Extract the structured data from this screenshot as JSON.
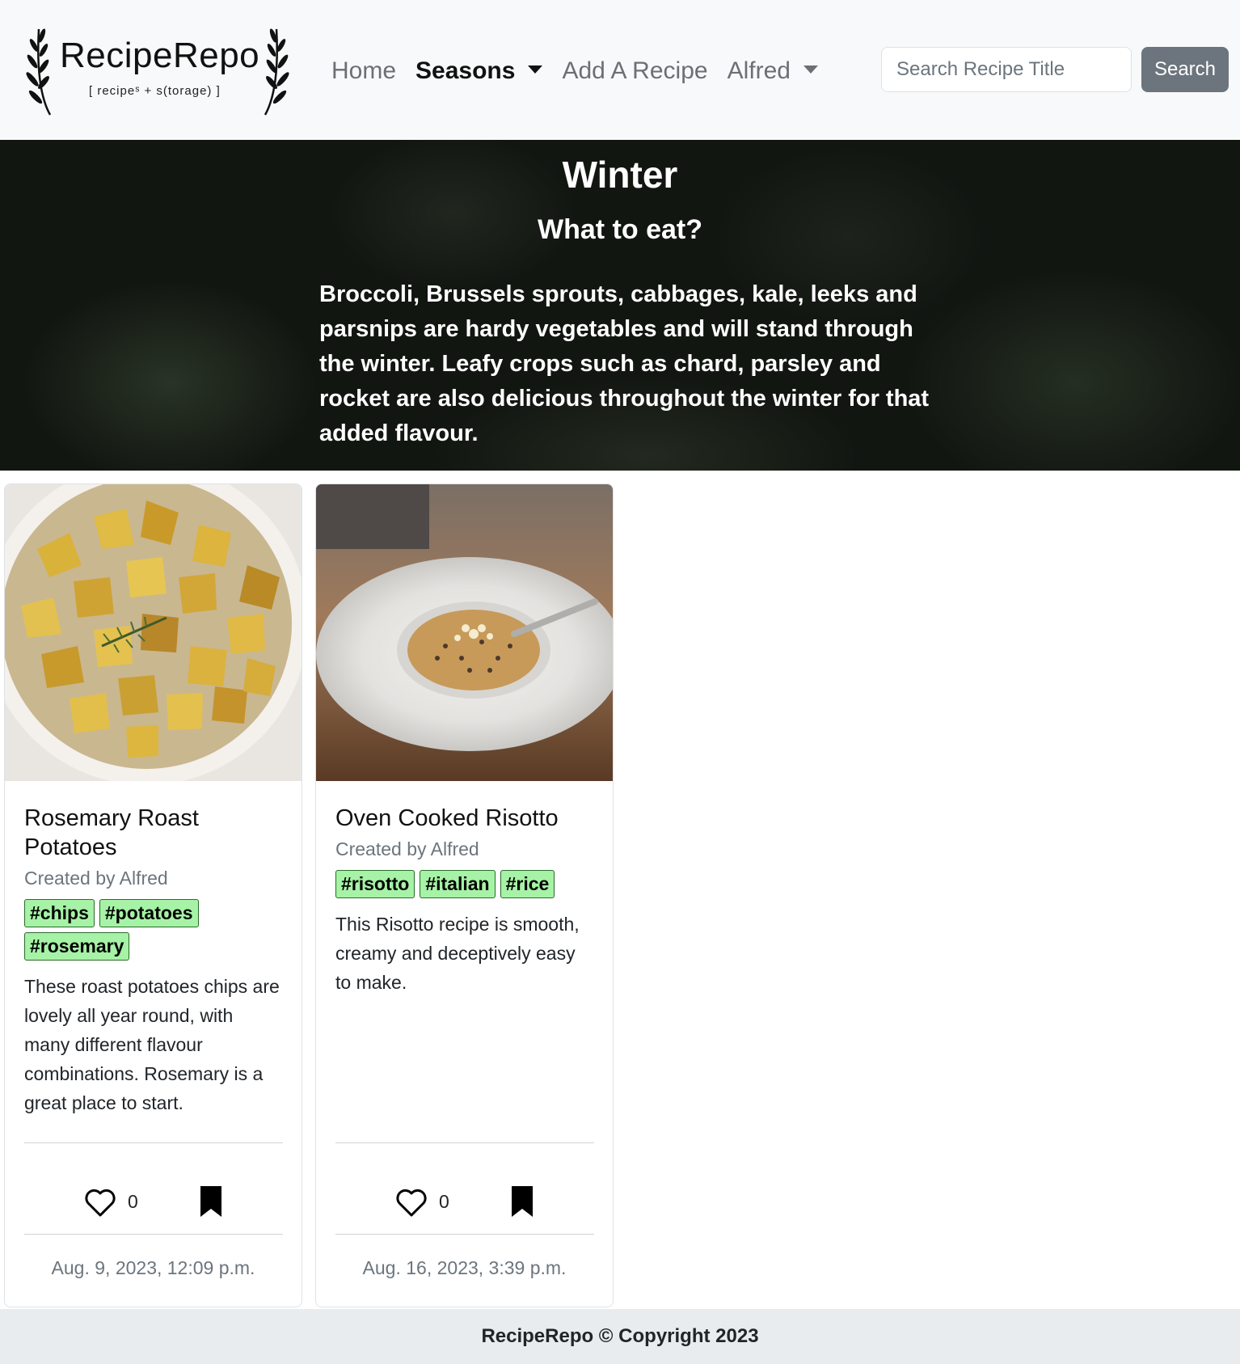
{
  "brand": {
    "title": "RecipeRepo",
    "subtitle": "[ recipeˢ + s(torage) ]"
  },
  "nav": {
    "home": "Home",
    "seasons": "Seasons",
    "add_recipe": "Add A Recipe",
    "user": "Alfred"
  },
  "search": {
    "placeholder": "Search Recipe Title",
    "button": "Search"
  },
  "hero": {
    "title": "Winter",
    "subtitle": "What to eat?",
    "text": "Broccoli, Brussels sprouts, cabbages, kale, leeks and parsnips are hardy vegetables and will stand through the winter. Leafy crops such as chard, parsley and rocket are also delicious throughout the winter for that added flavour."
  },
  "recipes": [
    {
      "title": "Rosemary Roast Potatoes",
      "author": "Created by Alfred",
      "tags": [
        "#chips",
        "#potatoes",
        "#rosemary"
      ],
      "description": "These roast potatoes chips are lovely all year round, with many different flavour combinations. Rosemary is a great place to start.",
      "likes": "0",
      "date": "Aug. 9, 2023, 12:09 p.m."
    },
    {
      "title": "Oven Cooked Risotto",
      "author": "Created by Alfred",
      "tags": [
        "#risotto",
        "#italian",
        "#rice"
      ],
      "description": "This Risotto recipe is smooth, creamy and deceptively easy to make.",
      "likes": "0",
      "date": "Aug. 16, 2023, 3:39 p.m."
    }
  ],
  "footer": {
    "text": "RecipeRepo © Copyright 2023"
  },
  "icons": {
    "laurel": "laurel-icon",
    "caret": "caret-down-icon",
    "heart": "heart-outline-icon",
    "bookmark": "bookmark-icon"
  },
  "colors": {
    "navbar_bg": "#f8f9fa",
    "search_button": "#6c757d",
    "tag_bg": "#a6f2a6",
    "footer_bg": "#e9ecef"
  }
}
